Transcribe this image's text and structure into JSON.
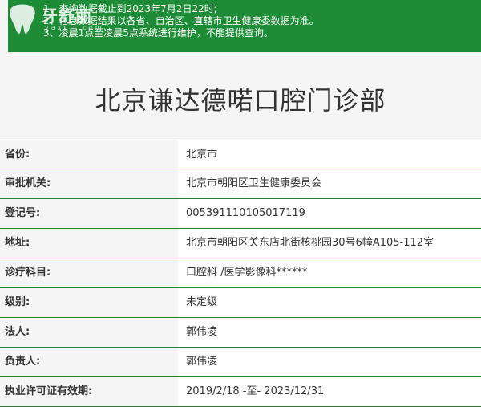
{
  "notice": {
    "lines": [
      "1、查询数据截止到2023年7月2日22时;",
      "2、信息数据结果以各省、自治区、直辖市卫生健康委数据为准。",
      "3、凌晨1点至凌晨5点系统进行维护，不能提供查询。"
    ]
  },
  "watermark": {
    "text": "牙舒丽",
    "sub": "yaxuli.com"
  },
  "page": {
    "title": "北京谦达德喏口腔门诊部"
  },
  "details": [
    {
      "label": "省份:",
      "value": "北京市"
    },
    {
      "label": "审批机关:",
      "value": "北京市朝阳区卫生健康委员会"
    },
    {
      "label": "登记号:",
      "value": "005391110105017119"
    },
    {
      "label": "地址:",
      "value": "北京市朝阳区关东店北街核桃园30号6幢A105-112室"
    },
    {
      "label": "诊疗科目:",
      "value": "口腔科 /医学影像科******"
    },
    {
      "label": "级别:",
      "value": "未定级"
    },
    {
      "label": "法人:",
      "value": "郭伟凌"
    },
    {
      "label": "负责人:",
      "value": "郭伟凌"
    },
    {
      "label": "执业许可证有效期:",
      "value": "2019/2/18 -至- 2023/12/31"
    }
  ],
  "colors": {
    "notice_bg": "#1e8c37",
    "row_border": "#2e7d32"
  }
}
